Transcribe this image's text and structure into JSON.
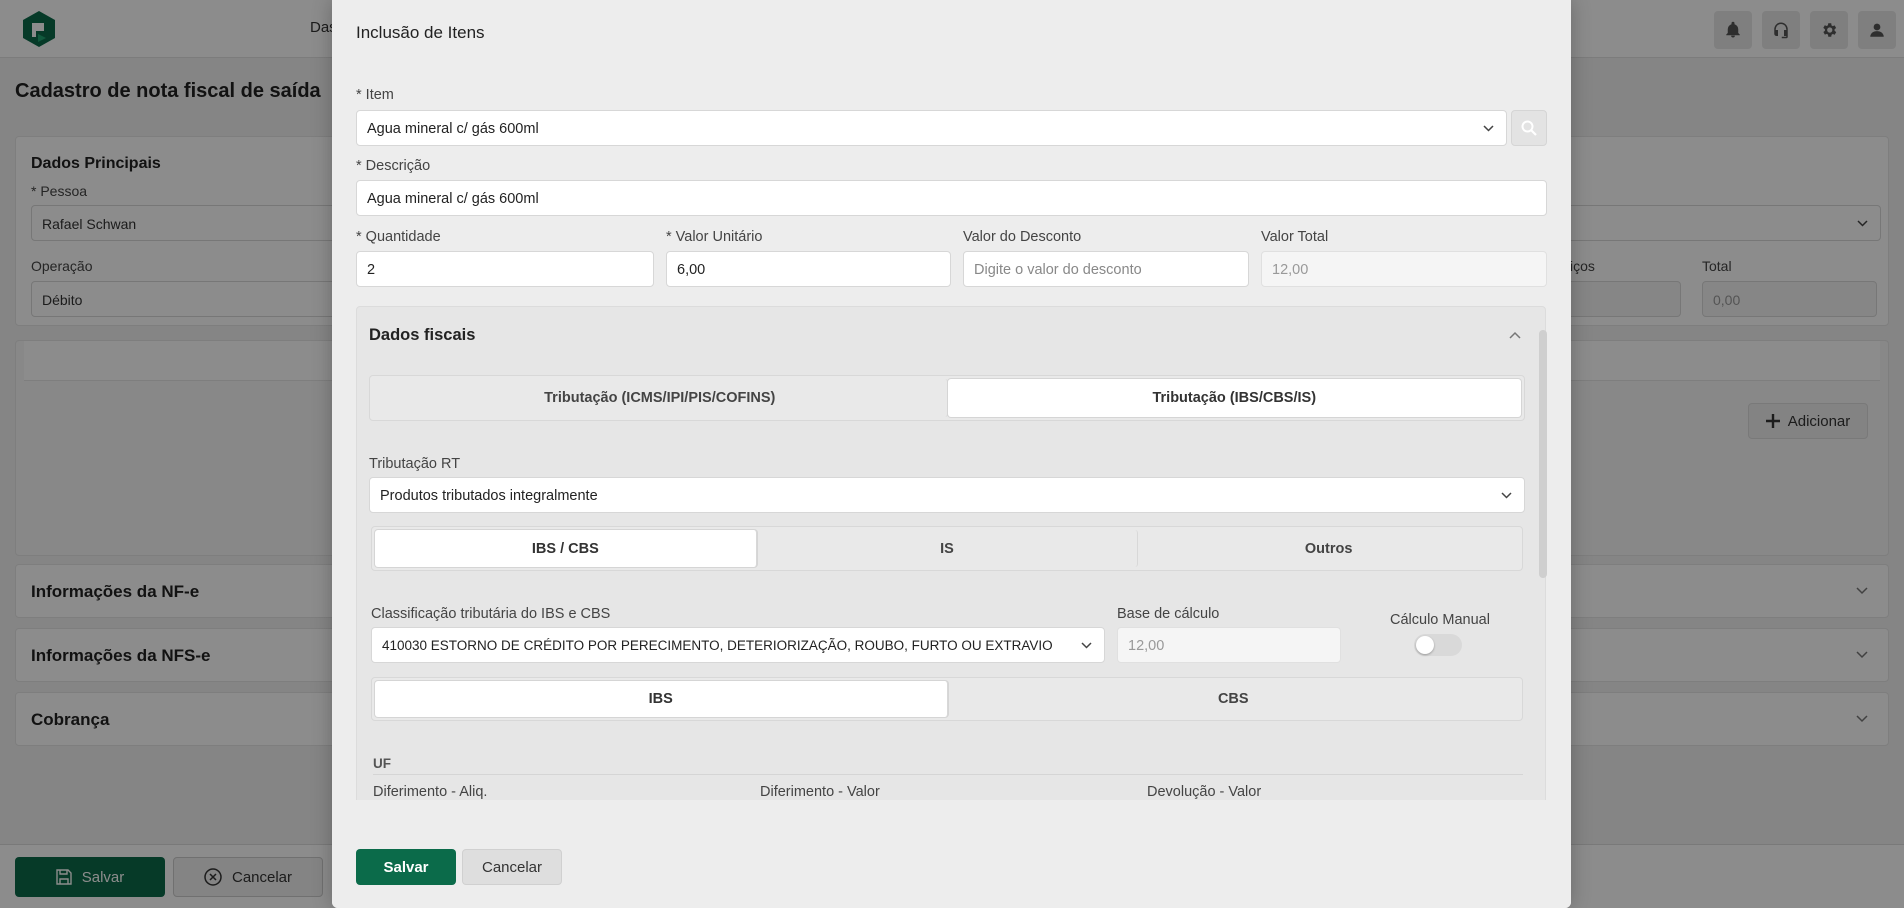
{
  "colors": {
    "brand": "#0b6b4a",
    "overlay": "rgba(0,0,0,0.45)"
  },
  "header": {
    "nav_text": "Das",
    "icons": [
      "bell-icon",
      "headset-icon",
      "gear-icon",
      "user-icon"
    ]
  },
  "page": {
    "title": "Cadastro de nota fiscal de saída",
    "dados_principais": {
      "title": "Dados Principais",
      "pessoa_label": "* Pessoa",
      "pessoa_value": "Rafael Schwan",
      "operacao_label": "Operação",
      "operacao_value": "Débito",
      "servicos_label": "iços",
      "total_label": "Total",
      "total_value": "0,00"
    },
    "add_button": "Adicionar",
    "sections": [
      "Informações da NF-e",
      "Informações da NFS-e",
      "Cobrança"
    ],
    "save_button": "Salvar",
    "cancel_button": "Cancelar"
  },
  "modal": {
    "title": "Inclusão de Itens",
    "item_label": "* Item",
    "item_value": "Agua mineral c/ gás 600ml",
    "descricao_label": "* Descrição",
    "descricao_value": "Agua mineral c/ gás 600ml",
    "quantidade_label": "* Quantidade",
    "quantidade_value": "2",
    "valor_unitario_label": "* Valor Unitário",
    "valor_unitario_value": "6,00",
    "valor_desconto_label": "Valor do Desconto",
    "valor_desconto_placeholder": "Digite o valor do desconto",
    "valor_total_label": "Valor Total",
    "valor_total_value": "12,00",
    "fiscal": {
      "title": "Dados fiscais",
      "main_tabs": [
        "Tributação (ICMS/IPI/PIS/COFINS)",
        "Tributação (IBS/CBS/IS)"
      ],
      "main_tab_active": 1,
      "tributacao_rt_label": "Tributação RT",
      "tributacao_rt_value": "Produtos tributados integralmente",
      "sub_tabs": [
        "IBS / CBS",
        "IS",
        "Outros"
      ],
      "sub_tab_active": 0,
      "classificacao_label": "Classificação tributária do IBS e CBS",
      "classificacao_value": "410030 ESTORNO DE CRÉDITO POR PERECIMENTO, DETERIORIZAÇÃO, ROUBO, FURTO OU EXTRAVIO",
      "base_calculo_label": "Base de cálculo",
      "base_calculo_value": "12,00",
      "calculo_manual_label": "Cálculo Manual",
      "calculo_manual_on": false,
      "ibs_tabs": [
        "IBS",
        "CBS"
      ],
      "ibs_tab_active": 0,
      "uf_label": "UF",
      "diferimento_aliq_label": "Diferimento - Aliq.",
      "diferimento_valor_label": "Diferimento - Valor",
      "devolucao_valor_label": "Devolução - Valor"
    },
    "save_button": "Salvar",
    "cancel_button": "Cancelar"
  }
}
